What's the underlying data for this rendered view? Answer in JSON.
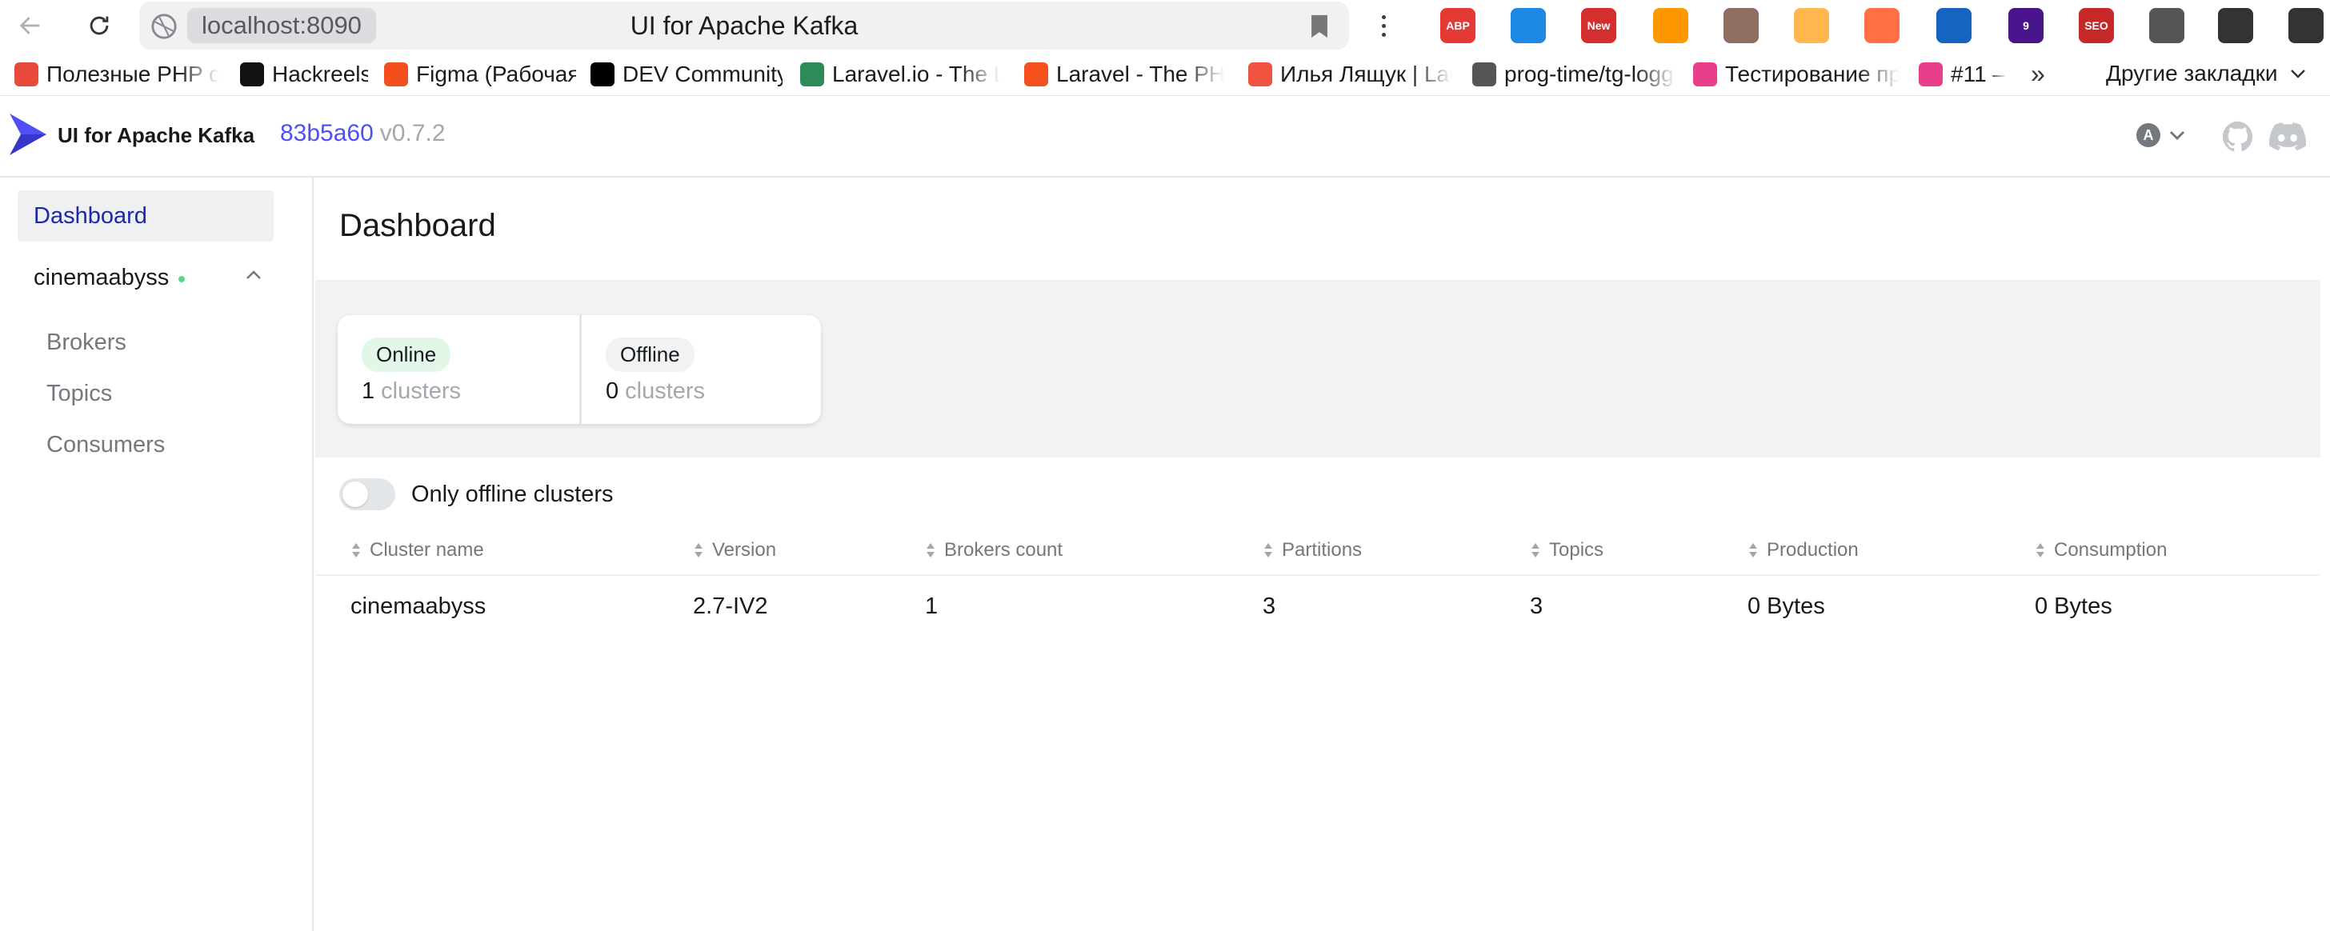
{
  "browser": {
    "url": "localhost:8090",
    "tab_title": "UI for Apache Kafka",
    "bookmarks": [
      {
        "label": "Полезные PHP ск",
        "color": "#e84b3c"
      },
      {
        "label": "Hackreels",
        "color": "#111111"
      },
      {
        "label": "Figma (Рабочая)",
        "color": "#f24e1e"
      },
      {
        "label": "DEV Community",
        "color": "#000000"
      },
      {
        "label": "Laravel.io - The La",
        "color": "#2e8b57"
      },
      {
        "label": "Laravel - The PHP",
        "color": "#f4511e"
      },
      {
        "label": "Илья Лящук | Lara",
        "color": "#f05340"
      },
      {
        "label": "prog-time/tg-logg",
        "color": "#555555"
      },
      {
        "label": "Тестирование про",
        "color": "#e83e8c"
      },
      {
        "label": "#11 –",
        "color": "#e83e8c"
      }
    ],
    "bookmarks_more": "»",
    "other_bookmarks": "Другие закладки",
    "extensions": [
      {
        "name": "adblock-icon",
        "text": "ABP",
        "color": "#e53935"
      },
      {
        "name": "download-ext-icon",
        "text": "",
        "color": "#1e88e5"
      },
      {
        "name": "new-ext-icon",
        "text": "New",
        "color": "#d32f2f"
      },
      {
        "name": "color-wheel-icon",
        "text": "",
        "color": "#ff9800"
      },
      {
        "name": "avatar-ext-icon",
        "text": "",
        "color": "#8d6e63"
      },
      {
        "name": "audio-ext-icon",
        "text": "",
        "color": "#ffb74d"
      },
      {
        "name": "rocket-icon",
        "text": "",
        "color": "#ff7043"
      },
      {
        "name": "chart-ext-icon",
        "text": "",
        "color": "#1565c0"
      },
      {
        "name": "hexagon-ext-icon",
        "text": "9",
        "color": "#4a148c"
      },
      {
        "name": "seo-ext-icon",
        "text": "SEO",
        "color": "#c62828"
      },
      {
        "name": "crosshair-icon",
        "text": "",
        "color": "#555555"
      },
      {
        "name": "puzzle-icon",
        "text": "",
        "color": "#333333"
      },
      {
        "name": "download-icon",
        "text": "",
        "color": "#333333"
      }
    ]
  },
  "header": {
    "app_name": "UI for Apache Kafka",
    "commit": "83b5a60",
    "version_tag": "v0.7.2",
    "avatar_letter": "A"
  },
  "sidebar": {
    "dashboard": "Dashboard",
    "cluster": "cinemaabyss",
    "items": [
      {
        "label": "Brokers"
      },
      {
        "label": "Topics"
      },
      {
        "label": "Consumers"
      }
    ]
  },
  "main": {
    "title": "Dashboard",
    "metrics": {
      "online_label": "Online",
      "online_count": "1",
      "online_unit": "clusters",
      "offline_label": "Offline",
      "offline_count": "0",
      "offline_unit": "clusters"
    },
    "toggle_label": "Only offline clusters",
    "table": {
      "columns": [
        "Cluster name",
        "Version",
        "Brokers count",
        "Partitions",
        "Topics",
        "Production",
        "Consumption"
      ],
      "rows": [
        [
          "cinemaabyss",
          "2.7-IV2",
          "1",
          "3",
          "3",
          "0 Bytes",
          "0 Bytes"
        ]
      ]
    }
  },
  "colors": {
    "accent": "#4f4ff6",
    "nav_active_text": "#1c28a8",
    "online_pill": "#e3f7e9",
    "status_dot": "#5cd685"
  }
}
